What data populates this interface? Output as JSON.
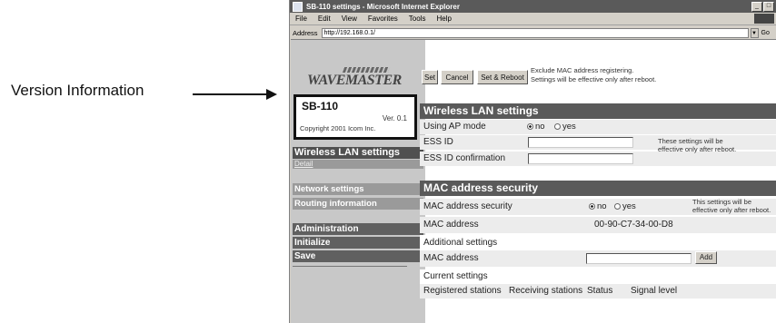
{
  "callout": {
    "label": "Version Information"
  },
  "window": {
    "title": "SB-110 settings - Microsoft Internet Explorer",
    "minimize": "_",
    "maximize": "□",
    "close": "×"
  },
  "menu": {
    "items": [
      "File",
      "Edit",
      "View",
      "Favorites",
      "Tools",
      "Help"
    ]
  },
  "address_bar": {
    "label": "Address",
    "value": "http://192.168.0.1/",
    "go": "Go"
  },
  "logo": {
    "text": "WAVEMASTER"
  },
  "version": {
    "model": "SB-110",
    "ver": "Ver. 0.1",
    "copyright": "Copyright 2001 Icom Inc."
  },
  "nav": {
    "wireless": "Wireless LAN settings",
    "detail": "Detail",
    "network": "Network settings",
    "routing": "Routing information",
    "admin": "Administration",
    "initialize": "Initialize",
    "save": "Save"
  },
  "toolbar": {
    "set": "Set",
    "cancel": "Cancel",
    "set_reboot": "Set & Reboot",
    "note1": "Exclude MAC address registering.",
    "note2": "Settings will be effective only after reboot."
  },
  "wireless": {
    "heading": "Wireless LAN settings",
    "ap_mode_label": "Using AP mode",
    "no": "no",
    "yes": "yes",
    "essid_label": "ESS ID",
    "essid_confirm_label": "ESS ID confirmation",
    "essid_value": "",
    "essid_confirm_value": "",
    "note1": "These settings will be",
    "note2": "effective only after reboot."
  },
  "mac": {
    "heading": "MAC address security",
    "security_label": "MAC address security",
    "no": "no",
    "yes": "yes",
    "note1": "This settings will be",
    "note2": "effective only after reboot.",
    "address_label": "MAC address",
    "address_value": "00-90-C7-34-00-D8",
    "additional_label": "Additional settings",
    "add_label": "MAC address",
    "add_button": "Add",
    "current_label": "Current settings",
    "columns": [
      "Registered stations",
      "Receiving stations",
      "Status",
      "Signal level"
    ]
  }
}
